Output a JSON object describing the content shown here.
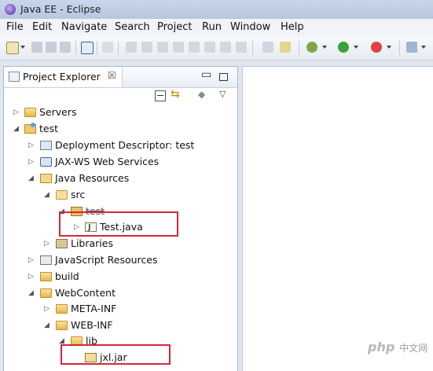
{
  "window": {
    "title": "Java EE - Eclipse"
  },
  "menu": [
    "File",
    "Edit",
    "Navigate",
    "Search",
    "Project",
    "Run",
    "Window",
    "Help"
  ],
  "explorer": {
    "tab_label": "Project Explorer",
    "tab_close": "☒"
  },
  "tree": [
    {
      "label": "Servers",
      "twisty": "▷",
      "icon": "folder-icon"
    },
    {
      "label": "test",
      "twisty": "◢",
      "icon": "project-icon"
    },
    {
      "label": "Deployment Descriptor: test",
      "twisty": "▷",
      "icon": "deployment-descriptor-icon"
    },
    {
      "label": "JAX-WS Web Services",
      "twisty": "▷",
      "icon": "web-services-icon"
    },
    {
      "label": "Java Resources",
      "twisty": "◢",
      "icon": "java-resources-icon"
    },
    {
      "label": "src",
      "twisty": "◢",
      "icon": "source-folder-icon"
    },
    {
      "label": "test",
      "twisty": "◢",
      "icon": "package-icon"
    },
    {
      "label": "Test.java",
      "twisty": "▷",
      "icon": "java-file-icon"
    },
    {
      "label": "Libraries",
      "twisty": "▷",
      "icon": "libraries-icon"
    },
    {
      "label": "JavaScript Resources",
      "twisty": "▷",
      "icon": "javascript-resources-icon"
    },
    {
      "label": "build",
      "twisty": "▷",
      "icon": "folder-icon"
    },
    {
      "label": "WebContent",
      "twisty": "◢",
      "icon": "folder-icon"
    },
    {
      "label": "META-INF",
      "twisty": "▷",
      "icon": "folder-icon"
    },
    {
      "label": "WEB-INF",
      "twisty": "◢",
      "icon": "folder-icon"
    },
    {
      "label": "lib",
      "twisty": "◢",
      "icon": "folder-icon"
    },
    {
      "label": "jxl.jar",
      "twisty": "",
      "icon": "jar-file-icon"
    }
  ],
  "watermark": {
    "logo": "php",
    "text": "中文网"
  }
}
